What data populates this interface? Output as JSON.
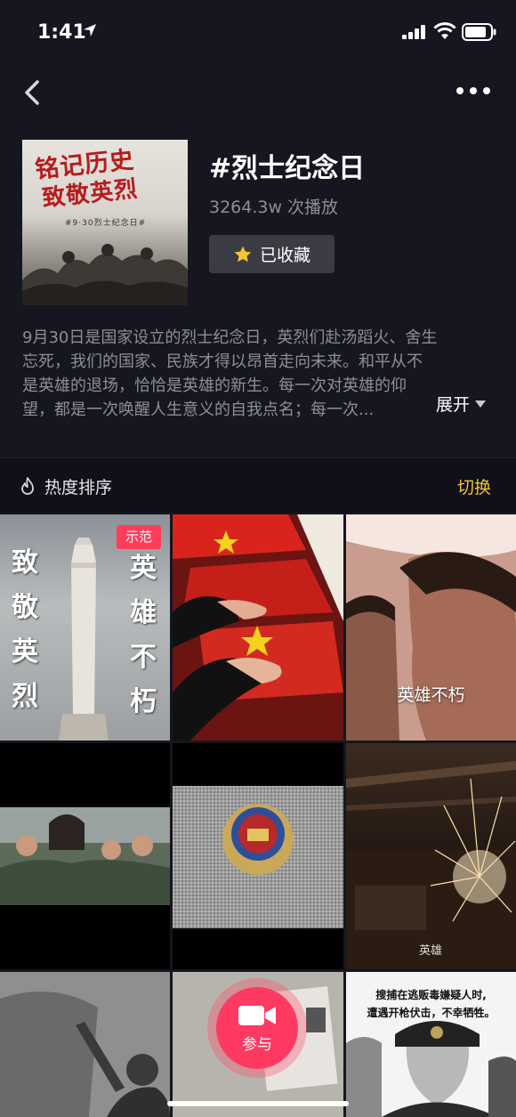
{
  "status_bar": {
    "time": "1:41"
  },
  "nav": {
    "back_icon": "chevron-left-icon",
    "more_icon": "ellipsis-icon"
  },
  "topic": {
    "cover_title_line1": "铭记历史",
    "cover_title_line2": "致敬英烈",
    "cover_subtitle": "#9·30烈士纪念日#",
    "title": "#烈士纪念日",
    "play_count": "3264.3w",
    "play_suffix": "次播放",
    "favorite_label": "已收藏",
    "favorite_icon": "star-icon",
    "favorite_color": "#f4c531"
  },
  "description": {
    "lines": [
      "9月30日是国家设立的烈士纪念日，英烈们赴汤蹈火、舍生",
      "忘死，我们的国家、民族才得以昂首走向未来。和平从不",
      "是英雄的退场，恰恰是英雄的新生。每一次对英雄的仰",
      "望，都是一次唤醒人生意义的自我点名；每一次..."
    ],
    "expand_label": "展开"
  },
  "sort": {
    "label": "热度排序",
    "switch_label": "切换",
    "switch_color": "#f4c531"
  },
  "grid": {
    "cell1": {
      "badge": "示范",
      "left_text": "致敬英烈",
      "right_text": "英雄不朽"
    },
    "cell3": {
      "caption": "英雄不朽"
    },
    "cell6": {
      "caption": "英雄"
    },
    "cell9": {
      "caption_line1": "搜捕在逃贩毒嫌疑人时,",
      "caption_line2": "遭遇开枪伏击，不幸牺牲。"
    }
  },
  "join_button": {
    "label": "参与",
    "icon": "video-camera-icon",
    "color": "#fe3a62"
  }
}
